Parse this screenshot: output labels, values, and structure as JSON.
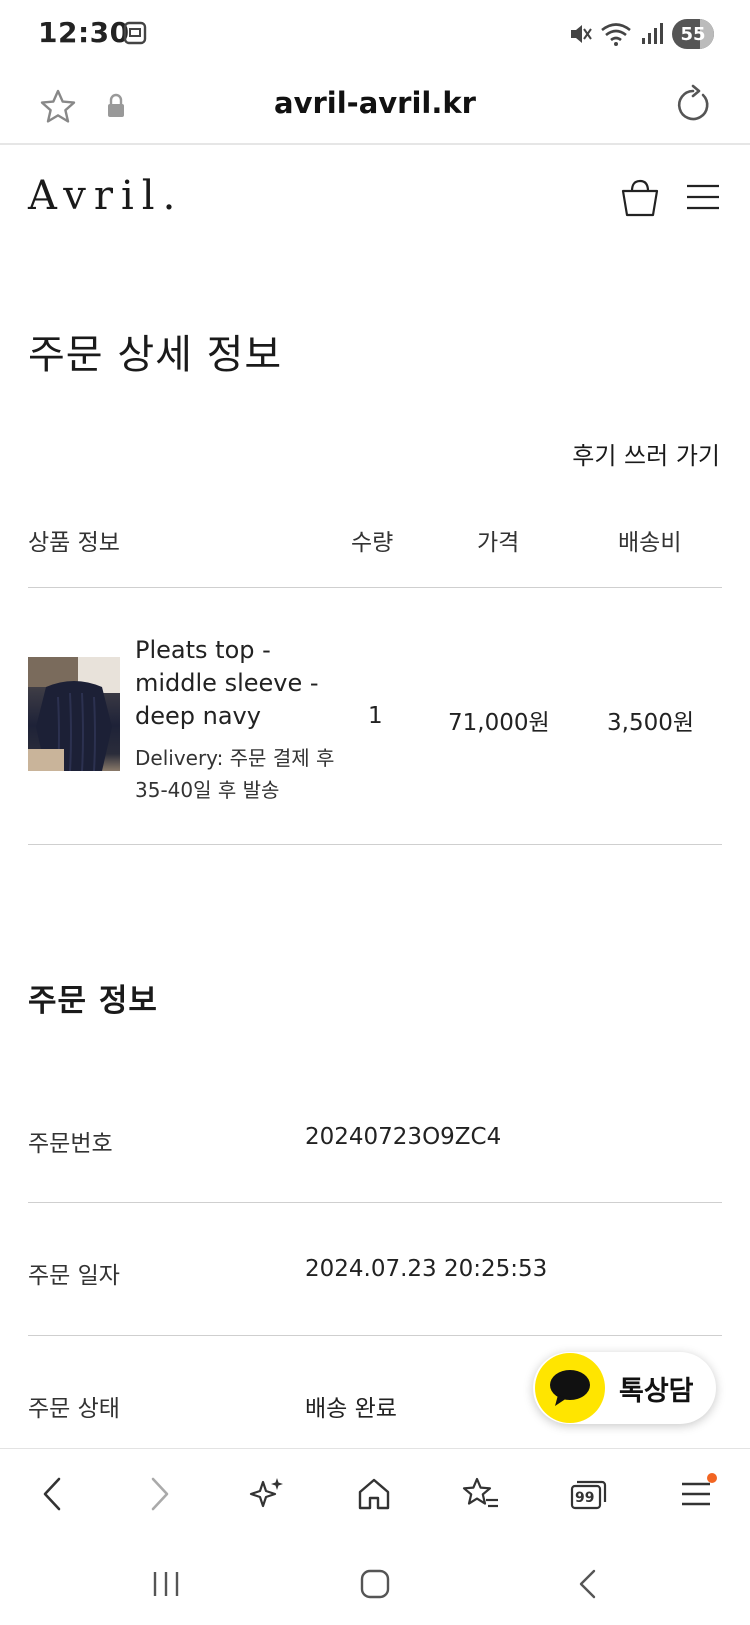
{
  "status_bar": {
    "time": "12:30",
    "battery": "55"
  },
  "browser": {
    "url": "avril-avril.kr"
  },
  "site": {
    "logo": "Avril."
  },
  "page": {
    "title": "주문 상세 정보",
    "review_link": "후기 쓰러 가기"
  },
  "order_table": {
    "headers": {
      "product": "상품 정보",
      "quantity": "수량",
      "price": "가격",
      "shipping": "배송비"
    },
    "item": {
      "name": "Pleats top - middle sleeve - deep navy",
      "delivery": "Delivery: 주문 결제 후 35-40일 후 발송",
      "quantity": "1",
      "price": "71,000원",
      "shipping": "3,500원"
    }
  },
  "order_info": {
    "title": "주문 정보",
    "rows": [
      {
        "label": "주문번호",
        "value": "20240723O9ZC4"
      },
      {
        "label": "주문 일자",
        "value": "2024.07.23 20:25:53"
      },
      {
        "label": "주문 상태",
        "value": "배송 완료"
      }
    ]
  },
  "chat": {
    "label": "톡상담",
    "accent": "#FFE500"
  },
  "bottom_nav": {
    "tabs_count": "99",
    "notification_color": "#F26522"
  }
}
